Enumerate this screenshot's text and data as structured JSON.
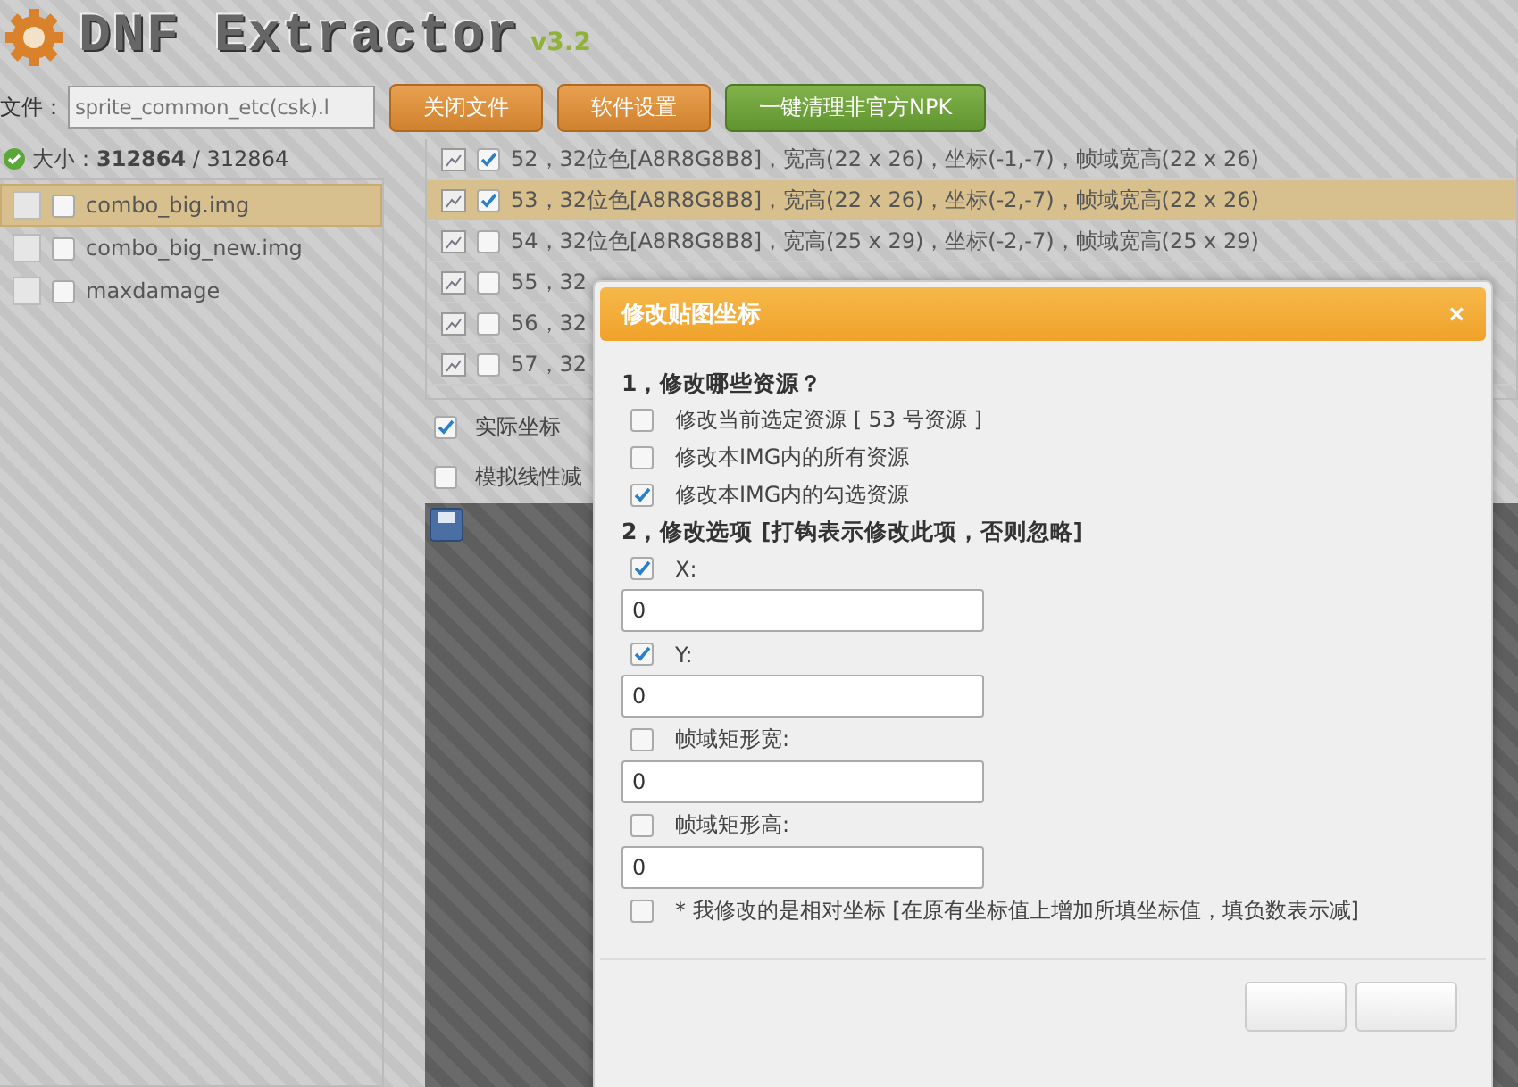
{
  "app": {
    "title": "DNF Extractor",
    "version": "v3.2"
  },
  "toolbar": {
    "file_label": "文件：",
    "file_value": "sprite_common_etc(csk).l",
    "buttons": [
      {
        "label": "关闭文件",
        "kind": "orange"
      },
      {
        "label": "软件设置",
        "kind": "orange"
      },
      {
        "label": "一键清理非官方NPK",
        "kind": "green"
      }
    ]
  },
  "size_info": "大小：**312864** / 312864",
  "files": [
    {
      "name": "combo_big.img",
      "checked": false,
      "selected": true
    },
    {
      "name": "combo_big_new.img",
      "checked": false,
      "selected": false
    },
    {
      "name": "maxdamage",
      "checked": false,
      "selected": false
    }
  ],
  "frames": [
    {
      "text": "52，32位色[A8R8G8B8]，宽高(22 x 26)，坐标(-1,-7)，帧域宽高(22 x 26)",
      "checked": true,
      "selected": false
    },
    {
      "text": "53，32位色[A8R8G8B8]，宽高(22 x 26)，坐标(-2,-7)，帧域宽高(22 x 26)",
      "checked": true,
      "selected": true
    },
    {
      "text": "54，32位色[A8R8G8B8]，宽高(25 x 29)，坐标(-2,-7)，帧域宽高(25 x 29)",
      "checked": false,
      "selected": false
    },
    {
      "text": "55，32",
      "checked": false,
      "selected": false
    },
    {
      "text": "56，32",
      "checked": false,
      "selected": false
    },
    {
      "text": "57，32",
      "checked": false,
      "selected": false
    }
  ],
  "options": [
    {
      "label": "实际坐标",
      "checked": true
    },
    {
      "label": "模拟线性减",
      "checked": false
    }
  ],
  "dialog": {
    "title": "修改贴图坐标",
    "close": "×",
    "scope_heading": "1，修改哪些资源？",
    "scope_choices": [
      {
        "label": "修改当前选定资源 [ 53 号资源 ]",
        "checked": false
      },
      {
        "label": "修改本IMG内的所有资源",
        "checked": false
      },
      {
        "label": "修改本IMG内的勾选资源",
        "checked": true
      }
    ],
    "fields_heading": "2，修改选项 [打钩表示修改此项，否则忽略]",
    "fields": [
      {
        "label": "X:",
        "checked": true,
        "value": "0"
      },
      {
        "label": "Y:",
        "checked": true,
        "value": "0"
      },
      {
        "label": "帧域矩形宽:",
        "checked": false,
        "value": "0"
      },
      {
        "label": "帧域矩形高:",
        "checked": false,
        "value": "0"
      }
    ],
    "relative": {
      "label": "* 我修改的是相对坐标 [在原有坐标值上增加所填坐标值，填负数表示减]",
      "checked": false
    }
  }
}
